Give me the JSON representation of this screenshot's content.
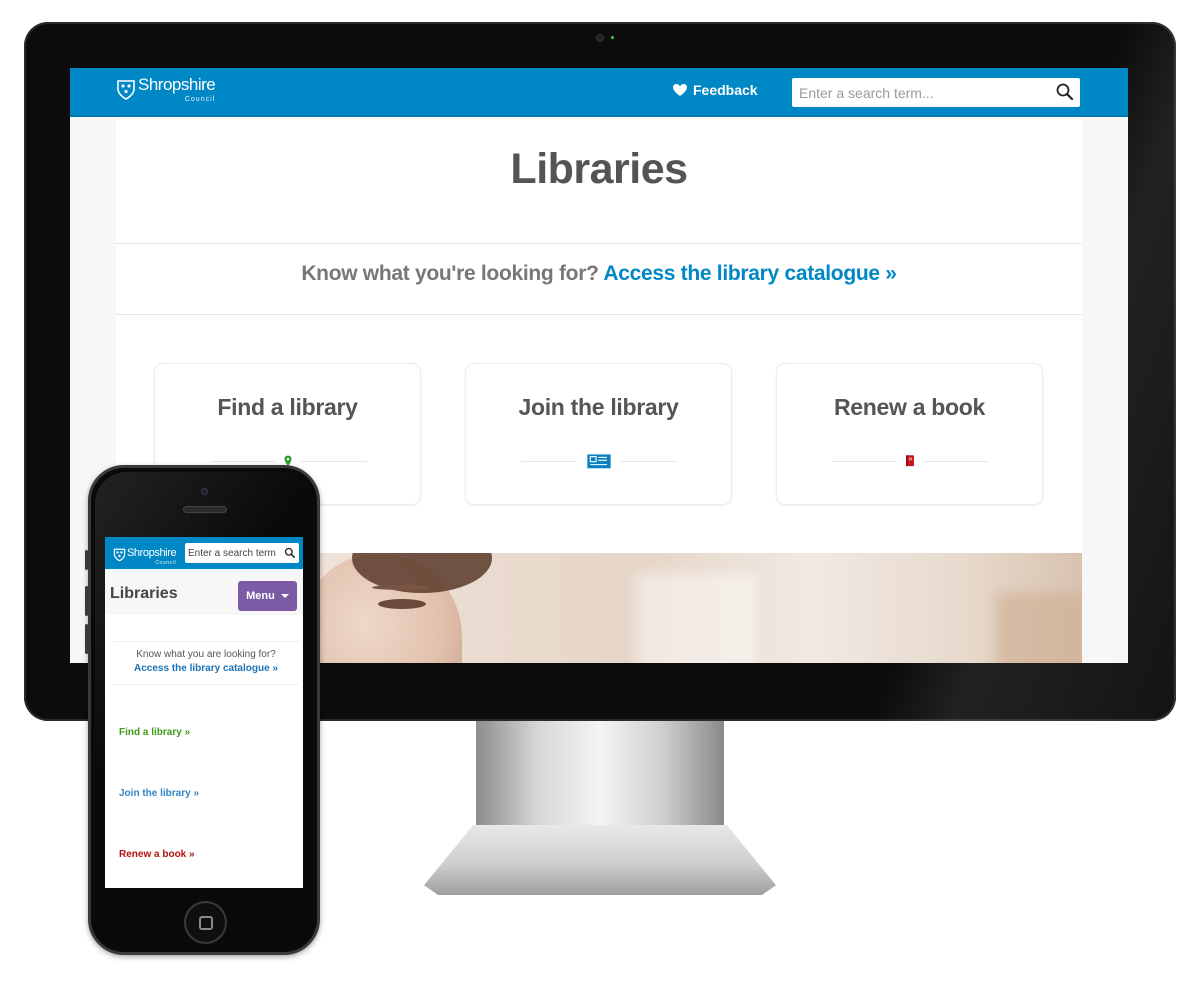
{
  "desktop": {
    "header": {
      "logo_name": "Shropshire",
      "logo_sub": "Council",
      "feedback_label": "Feedback",
      "search_placeholder": "Enter a search term..."
    },
    "page_title": "Libraries",
    "catalogue_prompt": "Know what you're looking for?",
    "catalogue_link": "Access the library catalogue »",
    "cards": [
      {
        "title": "Find a library",
        "icon": "map-pin-icon",
        "color": "#2b9a2b"
      },
      {
        "title": "Join the library",
        "icon": "library-card-icon",
        "color": "#0a7fc0"
      },
      {
        "title": "Renew a book",
        "icon": "book-icon",
        "color": "#c3171d"
      }
    ],
    "colors": {
      "brand": "#0087c6",
      "text": "#555555"
    }
  },
  "mobile": {
    "header": {
      "logo_name": "Shropshire",
      "logo_sub": "Council",
      "search_placeholder": "Enter a search term"
    },
    "page_title": "Libraries",
    "menu_label": "Menu",
    "catalogue_prompt": "Know what you are looking for?",
    "catalogue_link": "Access the library catalogue »",
    "links": [
      {
        "label": "Find a library »",
        "color": "#3c9a14"
      },
      {
        "label": "Join the library »",
        "color": "#2f86c9"
      },
      {
        "label": "Renew a book »",
        "color": "#b11212"
      }
    ],
    "colors": {
      "menu": "#7b5aa6"
    }
  }
}
